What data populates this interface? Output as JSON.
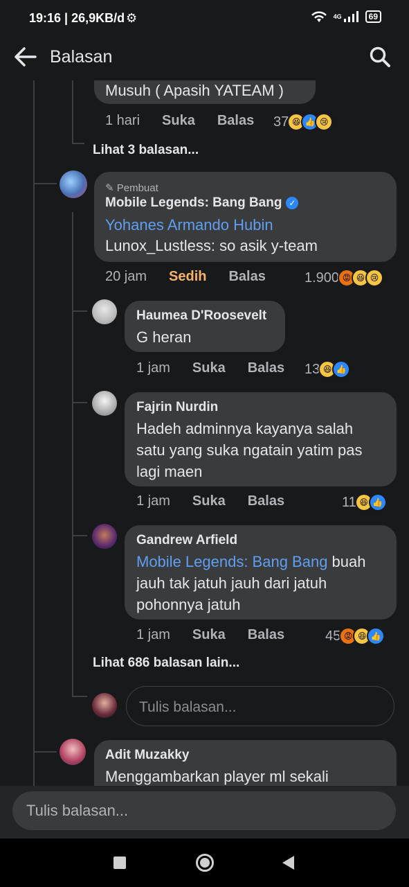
{
  "status_bar": {
    "time": "19:16 | 26,9KB/d",
    "network": "4G",
    "battery": "69"
  },
  "header": {
    "title": "Balasan"
  },
  "thread": {
    "top_comment": {
      "text_tail": "Musuh ( Apasih YATEAM )",
      "time": "1 hari",
      "like_label": "Suka",
      "reply_label": "Balas",
      "reaction_count": "37"
    },
    "view_replies_1": "Lihat 3 balasan...",
    "creator_comment": {
      "badge": "Pembuat",
      "author": "Mobile Legends: Bang Bang",
      "mention": "Yohanes Armando Hubin",
      "text": "Lunox_Lustless: so asik y-team",
      "time": "20 jam",
      "reaction_label": "Sedih",
      "reply_label": "Balas",
      "reaction_count": "1.900"
    },
    "replies": [
      {
        "author": "Haumea D'Roosevelt",
        "text": "G heran",
        "time": "1 jam",
        "like_label": "Suka",
        "reply_label": "Balas",
        "reaction_count": "13"
      },
      {
        "author": "Fajrin Nurdin",
        "text_lines": [
          "Hadeh adminnya kayanya salah",
          "satu yang suka ngatain yatim pas",
          "lagi maen"
        ],
        "time": "1 jam",
        "like_label": "Suka",
        "reply_label": "Balas",
        "reaction_count": "11"
      },
      {
        "author": "Gandrew Arfield",
        "mention": "Mobile Legends: Bang Bang",
        "text_first": " buah",
        "text_lines": [
          "jauh tak jatuh jauh dari jatuh",
          "pohonnya jatuh"
        ],
        "time": "1 jam",
        "like_label": "Suka",
        "reply_label": "Balas",
        "reaction_count": "45"
      }
    ],
    "view_replies_2": "Lihat 686 balasan lain...",
    "inline_reply_placeholder": "Tulis balasan...",
    "next_comment": {
      "author": "Adit Muzakky",
      "text": "Menggambarkan player ml sekali"
    }
  },
  "compose": {
    "placeholder": "Tulis balasan..."
  },
  "colors": {
    "background": "#18191a",
    "bubble": "#3a3b3c",
    "mention": "#5f9ef0",
    "sad_label": "#f7b36b",
    "verified": "#2d88ff"
  }
}
